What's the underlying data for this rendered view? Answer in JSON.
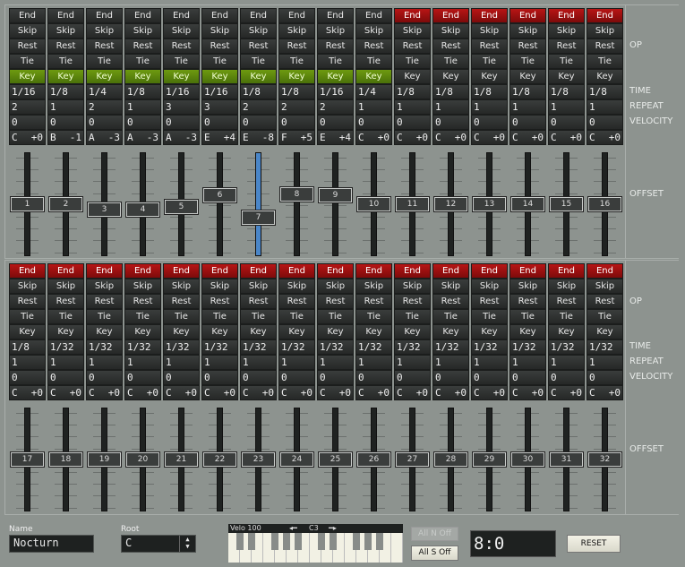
{
  "op_labels": [
    "End",
    "Skip",
    "Rest",
    "Tie",
    "Key"
  ],
  "row_labels": {
    "op": "OP",
    "time": "TIME",
    "repeat": "REPEAT",
    "velocity": "VELOCITY",
    "offset": "OFFSET"
  },
  "colors": {
    "end_active": "#b81515",
    "key_active": "#5f8a0e",
    "selected_slider": "#4a86c8",
    "background": "#8d938f"
  },
  "banks": [
    {
      "steps": [
        {
          "n": "1",
          "end": false,
          "key": true,
          "time": "1/16",
          "repeat": "2",
          "velocity": "0",
          "note": "C",
          "shift": "+0",
          "offset": 0
        },
        {
          "n": "2",
          "end": false,
          "key": true,
          "time": "1/8",
          "repeat": "1",
          "velocity": "0",
          "note": "B",
          "shift": "-1",
          "offset": 0
        },
        {
          "n": "3",
          "end": false,
          "key": true,
          "time": "1/4",
          "repeat": "2",
          "velocity": "0",
          "note": "A",
          "shift": "-3",
          "offset": -0.05
        },
        {
          "n": "4",
          "end": false,
          "key": true,
          "time": "1/8",
          "repeat": "1",
          "velocity": "0",
          "note": "A",
          "shift": "-3",
          "offset": -0.05
        },
        {
          "n": "5",
          "end": false,
          "key": true,
          "time": "1/16",
          "repeat": "3",
          "velocity": "0",
          "note": "A",
          "shift": "-3",
          "offset": -0.03
        },
        {
          "n": "6",
          "end": false,
          "key": true,
          "time": "1/16",
          "repeat": "3",
          "velocity": "0",
          "note": "E",
          "shift": "+4",
          "offset": 0.09
        },
        {
          "n": "7",
          "end": false,
          "key": true,
          "time": "1/8",
          "repeat": "2",
          "velocity": "0",
          "note": "E",
          "shift": "-8",
          "offset": -0.14,
          "selected": true
        },
        {
          "n": "8",
          "end": false,
          "key": true,
          "time": "1/8",
          "repeat": "2",
          "velocity": "0",
          "note": "F",
          "shift": "+5",
          "offset": 0.1
        },
        {
          "n": "9",
          "end": false,
          "key": true,
          "time": "1/16",
          "repeat": "2",
          "velocity": "0",
          "note": "E",
          "shift": "+4",
          "offset": 0.09
        },
        {
          "n": "10",
          "end": false,
          "key": true,
          "time": "1/4",
          "repeat": "1",
          "velocity": "0",
          "note": "C",
          "shift": "+0",
          "offset": 0
        },
        {
          "n": "11",
          "end": true,
          "key": false,
          "time": "1/8",
          "repeat": "1",
          "velocity": "0",
          "note": "C",
          "shift": "+0",
          "offset": 0
        },
        {
          "n": "12",
          "end": true,
          "key": false,
          "time": "1/8",
          "repeat": "1",
          "velocity": "0",
          "note": "C",
          "shift": "+0",
          "offset": 0
        },
        {
          "n": "13",
          "end": true,
          "key": false,
          "time": "1/8",
          "repeat": "1",
          "velocity": "0",
          "note": "C",
          "shift": "+0",
          "offset": 0
        },
        {
          "n": "14",
          "end": true,
          "key": false,
          "time": "1/8",
          "repeat": "1",
          "velocity": "0",
          "note": "C",
          "shift": "+0",
          "offset": 0
        },
        {
          "n": "15",
          "end": true,
          "key": false,
          "time": "1/8",
          "repeat": "1",
          "velocity": "0",
          "note": "C",
          "shift": "+0",
          "offset": 0
        },
        {
          "n": "16",
          "end": true,
          "key": false,
          "time": "1/8",
          "repeat": "1",
          "velocity": "0",
          "note": "C",
          "shift": "+0",
          "offset": 0
        }
      ]
    },
    {
      "steps": [
        {
          "n": "17",
          "end": true,
          "key": false,
          "time": "1/8",
          "repeat": "1",
          "velocity": "0",
          "note": "C",
          "shift": "+0",
          "offset": 0
        },
        {
          "n": "18",
          "end": true,
          "key": false,
          "time": "1/32",
          "repeat": "1",
          "velocity": "0",
          "note": "C",
          "shift": "+0",
          "offset": 0
        },
        {
          "n": "19",
          "end": true,
          "key": false,
          "time": "1/32",
          "repeat": "1",
          "velocity": "0",
          "note": "C",
          "shift": "+0",
          "offset": 0
        },
        {
          "n": "20",
          "end": true,
          "key": false,
          "time": "1/32",
          "repeat": "1",
          "velocity": "0",
          "note": "C",
          "shift": "+0",
          "offset": 0
        },
        {
          "n": "21",
          "end": true,
          "key": false,
          "time": "1/32",
          "repeat": "1",
          "velocity": "0",
          "note": "C",
          "shift": "+0",
          "offset": 0
        },
        {
          "n": "22",
          "end": true,
          "key": false,
          "time": "1/32",
          "repeat": "1",
          "velocity": "0",
          "note": "C",
          "shift": "+0",
          "offset": 0
        },
        {
          "n": "23",
          "end": true,
          "key": false,
          "time": "1/32",
          "repeat": "1",
          "velocity": "0",
          "note": "C",
          "shift": "+0",
          "offset": 0
        },
        {
          "n": "24",
          "end": true,
          "key": false,
          "time": "1/32",
          "repeat": "1",
          "velocity": "0",
          "note": "C",
          "shift": "+0",
          "offset": 0
        },
        {
          "n": "25",
          "end": true,
          "key": false,
          "time": "1/32",
          "repeat": "1",
          "velocity": "0",
          "note": "C",
          "shift": "+0",
          "offset": 0
        },
        {
          "n": "26",
          "end": true,
          "key": false,
          "time": "1/32",
          "repeat": "1",
          "velocity": "0",
          "note": "C",
          "shift": "+0",
          "offset": 0
        },
        {
          "n": "27",
          "end": true,
          "key": false,
          "time": "1/32",
          "repeat": "1",
          "velocity": "0",
          "note": "C",
          "shift": "+0",
          "offset": 0
        },
        {
          "n": "28",
          "end": true,
          "key": false,
          "time": "1/32",
          "repeat": "1",
          "velocity": "0",
          "note": "C",
          "shift": "+0",
          "offset": 0
        },
        {
          "n": "29",
          "end": true,
          "key": false,
          "time": "1/32",
          "repeat": "1",
          "velocity": "0",
          "note": "C",
          "shift": "+0",
          "offset": 0
        },
        {
          "n": "30",
          "end": true,
          "key": false,
          "time": "1/32",
          "repeat": "1",
          "velocity": "0",
          "note": "C",
          "shift": "+0",
          "offset": 0
        },
        {
          "n": "31",
          "end": true,
          "key": false,
          "time": "1/32",
          "repeat": "1",
          "velocity": "0",
          "note": "C",
          "shift": "+0",
          "offset": 0
        },
        {
          "n": "32",
          "end": true,
          "key": false,
          "time": "1/32",
          "repeat": "1",
          "velocity": "0",
          "note": "C",
          "shift": "+0",
          "offset": 0
        }
      ]
    }
  ],
  "footer": {
    "name_label": "Name",
    "name_value": "Nocturn",
    "root_label": "Root",
    "root_value": "C",
    "keyboard": {
      "velocity": "Velo 100",
      "octave": "C3"
    },
    "all_notes_off": "All N Off",
    "all_sound_off": "All S Off",
    "position": "8:0",
    "reset": "RESET"
  }
}
